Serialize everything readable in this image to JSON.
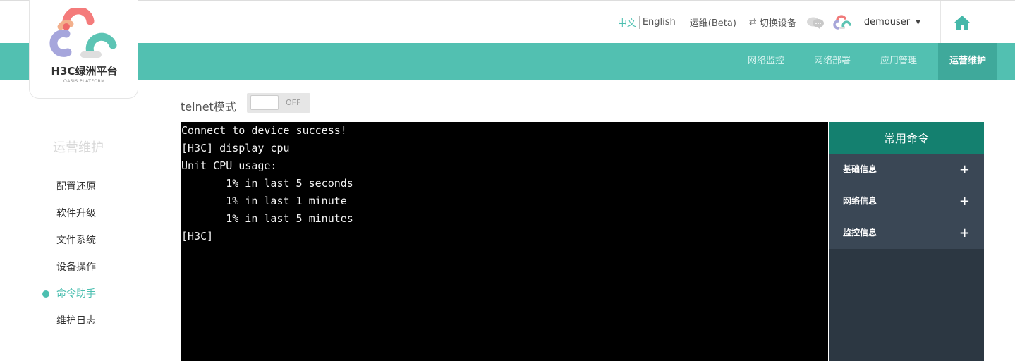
{
  "brand": {
    "name": "H3C绿洲平台",
    "subtitle": "OASIS PLATFORM"
  },
  "header": {
    "lang_zh": "中文",
    "lang_en": "English",
    "ops_beta": "运维(Beta)",
    "switch_device": "切换设备",
    "username": "demouser",
    "icons": [
      "switch-arrows-icon",
      "chat-bubbles-icon",
      "cloud-logo-icon",
      "caret-down-icon",
      "home-icon"
    ]
  },
  "nav": {
    "items": [
      {
        "label": "网络监控"
      },
      {
        "label": "网络部署"
      },
      {
        "label": "应用管理"
      },
      {
        "label": "运营维护"
      }
    ],
    "active": "运营维护"
  },
  "sidebar": {
    "title": "运营维护",
    "items": [
      {
        "label": "配置还原"
      },
      {
        "label": "软件升级"
      },
      {
        "label": "文件系统"
      },
      {
        "label": "设备操作"
      },
      {
        "label": "命令助手"
      },
      {
        "label": "维护日志"
      }
    ],
    "active": "命令助手"
  },
  "telnet": {
    "label": "telnet模式",
    "toggle_state": "OFF"
  },
  "terminal": {
    "lines": [
      "Connect to device success!",
      "[H3C] display cpu",
      "Unit CPU usage:",
      "       1% in last 5 seconds",
      "       1% in last 1 minute",
      "       1% in last 5 minutes",
      "[H3C]"
    ]
  },
  "commands": {
    "title": "常用命令",
    "groups": [
      {
        "label": "基础信息",
        "expand": "+"
      },
      {
        "label": "网络信息",
        "expand": "+"
      },
      {
        "label": "监控信息",
        "expand": "+"
      }
    ]
  },
  "colors": {
    "accent": "#52c0b1",
    "nav_active": "#3fa99b",
    "panel_header": "#14806f",
    "panel_body": "#2c3742",
    "panel_items": "#3a4755",
    "terminal_bg": "#000000"
  }
}
